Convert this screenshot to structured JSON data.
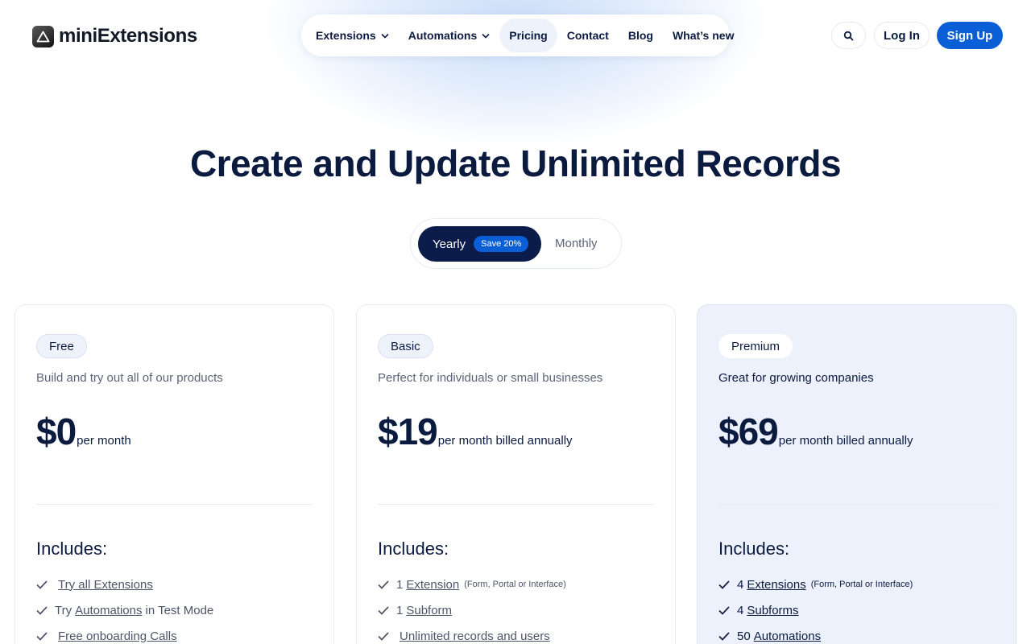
{
  "header": {
    "logo_text": "miniExtensions",
    "nav": [
      {
        "label": "Extensions",
        "dropdown": true
      },
      {
        "label": "Automations",
        "dropdown": true
      },
      {
        "label": "Pricing",
        "active": true
      },
      {
        "label": "Contact"
      },
      {
        "label": "Blog"
      },
      {
        "label": "What’s new"
      }
    ],
    "search_icon": "search-icon",
    "login_label": "Log In",
    "signup_label": "Sign Up"
  },
  "hero": {
    "title": "Create and Update Unlimited Records",
    "toggle": {
      "yearly_label": "Yearly",
      "save_badge": "Save 20%",
      "monthly_label": "Monthly",
      "selected": "Yearly"
    }
  },
  "plans": [
    {
      "name": "Free",
      "description": "Build and try out all of our products",
      "price": "$0",
      "period": "per month",
      "includes_label": "Includes:",
      "features": [
        {
          "before": "",
          "link": "Try all Extensions",
          "after": "",
          "small": ""
        },
        {
          "before": "Try",
          "link": "Automations",
          "after": "in Test Mode",
          "small": ""
        },
        {
          "before": "",
          "link": "Free onboarding Calls",
          "after": "",
          "small": ""
        }
      ]
    },
    {
      "name": "Basic",
      "description": "Perfect for individuals or small businesses",
      "price": "$19",
      "period": "per month billed annually",
      "includes_label": "Includes:",
      "features": [
        {
          "before": "1",
          "link": "Extension",
          "after": "",
          "small": "(Form, Portal or Interface)"
        },
        {
          "before": "1",
          "link": "Subform",
          "after": "",
          "small": ""
        },
        {
          "before": "",
          "link": "Unlimited records and users",
          "after": "",
          "small": ""
        }
      ]
    },
    {
      "name": "Premium",
      "description": "Great for growing companies",
      "price": "$69",
      "period": "per month billed annually",
      "includes_label": "Includes:",
      "features": [
        {
          "before": "4",
          "link": "Extensions",
          "after": "",
          "small": "(Form, Portal or Interface)"
        },
        {
          "before": "4",
          "link": "Subforms",
          "after": "",
          "small": ""
        },
        {
          "before": "50",
          "link": "Automations",
          "after": "",
          "small": ""
        }
      ]
    }
  ],
  "colors": {
    "primary": "#0a5fd6",
    "navy": "#0b1b4a",
    "text": "#0b1b3f",
    "premium_bg": "#edf1fc"
  }
}
